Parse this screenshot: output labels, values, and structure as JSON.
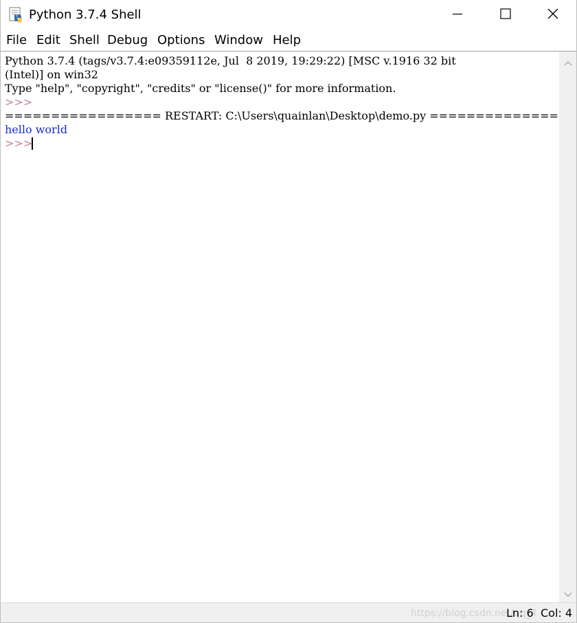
{
  "window": {
    "title": "Python 3.7.4 Shell",
    "icon": "python-idle-icon",
    "controls": [
      "minimize-icon",
      "maximize-icon",
      "close-icon"
    ]
  },
  "menu": {
    "file": "File",
    "edit": "Edit",
    "shell": "Shell",
    "debug": "Debug",
    "options": "Options",
    "window": "Window",
    "help": "Help"
  },
  "shell": {
    "banner_line1": "Python 3.7.4 (tags/v3.7.4:e09359112e, Jul  8 2019, 19:29:22) [MSC v.1916 32 bit",
    "banner_line2": "(Intel)] on win32",
    "banner_line3": "Type \"help\", \"copyright\", \"credits\" or \"license()\" for more information.",
    "prompt1": ">>>",
    "restart_line": "================= RESTART: C:\\Users\\quainlan\\Desktop\\demo.py =================",
    "output_line": "hello world",
    "prompt2": ">>>"
  },
  "colors": {
    "prompt": "#c77c8e",
    "output": "#1a2bd8",
    "text": "#000000"
  },
  "statusbar": {
    "ln": "Ln: 6",
    "col": "Col: 4",
    "watermark": "https://blog.csdn.net/qq_4"
  }
}
